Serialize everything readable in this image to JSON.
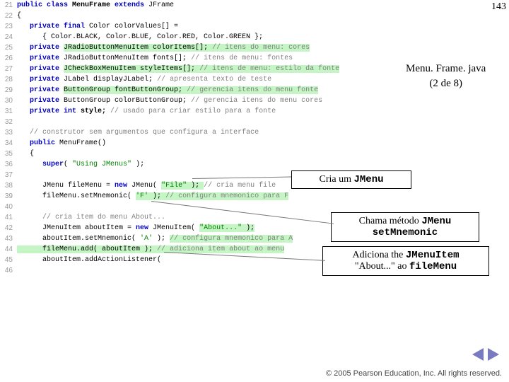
{
  "pageNumber": "143",
  "lines": [
    {
      "n": "21",
      "segs": [
        {
          "t": "public class ",
          "c": "c-kw"
        },
        {
          "t": "MenuFrame ",
          "c": "c-bold"
        },
        {
          "t": "extends ",
          "c": "c-kw"
        },
        {
          "t": "JFrame",
          "c": "c-plain"
        }
      ]
    },
    {
      "n": "22",
      "segs": [
        {
          "t": "{",
          "c": "c-plain"
        }
      ]
    },
    {
      "n": "23",
      "segs": [
        {
          "t": "   ",
          "c": "c-plain"
        },
        {
          "t": "private final ",
          "c": "c-kw"
        },
        {
          "t": "Color colorValues[] =",
          "c": "c-plain"
        }
      ]
    },
    {
      "n": "24",
      "segs": [
        {
          "t": "      { Color.BLACK, Color.BLUE, Color.RED, Color.GREEN };",
          "c": "c-plain"
        }
      ]
    },
    {
      "n": "25",
      "segs": [
        {
          "t": "   ",
          "c": "c-plain"
        },
        {
          "t": "private ",
          "c": "c-kw"
        },
        {
          "t": "JRadioButtonMenuItem colorItems[]; ",
          "c": "c-plain",
          "hl": true
        },
        {
          "t": "// itens do menu: cores",
          "c": "c-com",
          "hl": true
        }
      ]
    },
    {
      "n": "26",
      "segs": [
        {
          "t": "   ",
          "c": "c-plain"
        },
        {
          "t": "private ",
          "c": "c-kw"
        },
        {
          "t": "JRadioButtonMenuItem fonts[]; ",
          "c": "c-plain"
        },
        {
          "t": "// itens de menu: fontes",
          "c": "c-com"
        }
      ]
    },
    {
      "n": "27",
      "segs": [
        {
          "t": "   ",
          "c": "c-plain"
        },
        {
          "t": "private ",
          "c": "c-kw"
        },
        {
          "t": "JCheckBoxMenuItem styleItems[]; ",
          "c": "c-plain",
          "hl": true
        },
        {
          "t": "// itens de menu: estilo da fonte",
          "c": "c-com",
          "hl": true
        }
      ]
    },
    {
      "n": "28",
      "segs": [
        {
          "t": "   ",
          "c": "c-plain"
        },
        {
          "t": "private ",
          "c": "c-kw"
        },
        {
          "t": "JLabel displayJLabel; ",
          "c": "c-plain"
        },
        {
          "t": "// apresenta texto de teste",
          "c": "c-com"
        }
      ]
    },
    {
      "n": "29",
      "segs": [
        {
          "t": "   ",
          "c": "c-plain"
        },
        {
          "t": "private ",
          "c": "c-kw"
        },
        {
          "t": "ButtonGroup fontButtonGroup; ",
          "c": "c-plain",
          "hl": true
        },
        {
          "t": "// gerencia itens do menu fonte",
          "c": "c-com",
          "hl": true
        }
      ]
    },
    {
      "n": "30",
      "segs": [
        {
          "t": "   ",
          "c": "c-plain"
        },
        {
          "t": "private ",
          "c": "c-kw"
        },
        {
          "t": "ButtonGroup colorButtonGroup; ",
          "c": "c-plain"
        },
        {
          "t": "// gerencia itens do menu cores",
          "c": "c-com"
        }
      ]
    },
    {
      "n": "31",
      "segs": [
        {
          "t": "   ",
          "c": "c-plain"
        },
        {
          "t": "private int ",
          "c": "c-kw"
        },
        {
          "t": "style; ",
          "c": "c-bold"
        },
        {
          "t": "// usado para criar estilo para a fonte",
          "c": "c-com"
        }
      ]
    },
    {
      "n": "32",
      "segs": [
        {
          "t": "",
          "c": "c-plain"
        }
      ]
    },
    {
      "n": "33",
      "segs": [
        {
          "t": "   ",
          "c": "c-plain"
        },
        {
          "t": "// construtor sem argumentos que configura a interface",
          "c": "c-com"
        }
      ]
    },
    {
      "n": "34",
      "segs": [
        {
          "t": "   ",
          "c": "c-plain"
        },
        {
          "t": "public ",
          "c": "c-kw"
        },
        {
          "t": "MenuFrame()",
          "c": "c-plain"
        }
      ]
    },
    {
      "n": "35",
      "segs": [
        {
          "t": "   {",
          "c": "c-plain"
        }
      ]
    },
    {
      "n": "36",
      "segs": [
        {
          "t": "      ",
          "c": "c-plain"
        },
        {
          "t": "super",
          "c": "c-kw"
        },
        {
          "t": "( ",
          "c": "c-plain"
        },
        {
          "t": "\"Using JMenus\"",
          "c": "c-str"
        },
        {
          "t": " );",
          "c": "c-plain"
        }
      ]
    },
    {
      "n": "37",
      "segs": [
        {
          "t": "",
          "c": "c-plain"
        }
      ]
    },
    {
      "n": "38",
      "segs": [
        {
          "t": "      JMenu fileMenu = ",
          "c": "c-plain"
        },
        {
          "t": "new ",
          "c": "c-kw"
        },
        {
          "t": "JMenu( ",
          "c": "c-plain"
        },
        {
          "t": "\"File\"",
          "c": "c-str",
          "hl": true
        },
        {
          "t": " ); ",
          "c": "c-plain",
          "hl": true
        },
        {
          "t": "// cria menu file",
          "c": "c-com"
        }
      ]
    },
    {
      "n": "39",
      "segs": [
        {
          "t": "      fileMenu.setMnemonic( ",
          "c": "c-plain"
        },
        {
          "t": "'F'",
          "c": "c-str",
          "hl": true
        },
        {
          "t": " ); ",
          "c": "c-plain",
          "hl": true
        },
        {
          "t": "// configura mnemonico para F",
          "c": "c-com",
          "hl": true
        }
      ]
    },
    {
      "n": "40",
      "segs": [
        {
          "t": "",
          "c": "c-plain"
        }
      ]
    },
    {
      "n": "41",
      "segs": [
        {
          "t": "      ",
          "c": "c-plain"
        },
        {
          "t": "// cria item do menu About...",
          "c": "c-com"
        }
      ]
    },
    {
      "n": "42",
      "segs": [
        {
          "t": "      JMenuItem aboutItem = ",
          "c": "c-plain"
        },
        {
          "t": "new ",
          "c": "c-kw"
        },
        {
          "t": "JMenuItem( ",
          "c": "c-plain"
        },
        {
          "t": "\"About...\"",
          "c": "c-str",
          "hl": true
        },
        {
          "t": " );",
          "c": "c-plain",
          "hl": true
        }
      ]
    },
    {
      "n": "43",
      "segs": [
        {
          "t": "      aboutItem.setMnemonic( ",
          "c": "c-plain"
        },
        {
          "t": "'A'",
          "c": "c-str"
        },
        {
          "t": " ); ",
          "c": "c-plain"
        },
        {
          "t": "// configura mnemonico para A",
          "c": "c-com",
          "hl": true
        }
      ]
    },
    {
      "n": "44",
      "segs": [
        {
          "t": "      fileMenu.add( aboutItem ); ",
          "c": "c-plain",
          "hl": true
        },
        {
          "t": "// adiciona item about ao menu",
          "c": "c-com",
          "hl": true
        }
      ]
    },
    {
      "n": "45",
      "segs": [
        {
          "t": "      aboutItem.addActionListener(",
          "c": "c-plain"
        }
      ]
    },
    {
      "n": "46",
      "segs": [
        {
          "t": "",
          "c": "c-plain"
        }
      ]
    }
  ],
  "callout1": {
    "title": "Menu. Frame. java",
    "sub": "(2 de 8)"
  },
  "callout2": {
    "pre": "Cria um ",
    "mono": "JMenu"
  },
  "callout3": {
    "pre": "Chama método ",
    "mono": "JMenu",
    "line2": "setMnemonic"
  },
  "callout4": {
    "pre": "Adiciona the ",
    "mono1": "JMenuItem",
    "mid": "\"About...\" ao ",
    "mono2": "fileMenu"
  },
  "footer": "  2005 Pearson Education, Inc.  All rights reserved."
}
